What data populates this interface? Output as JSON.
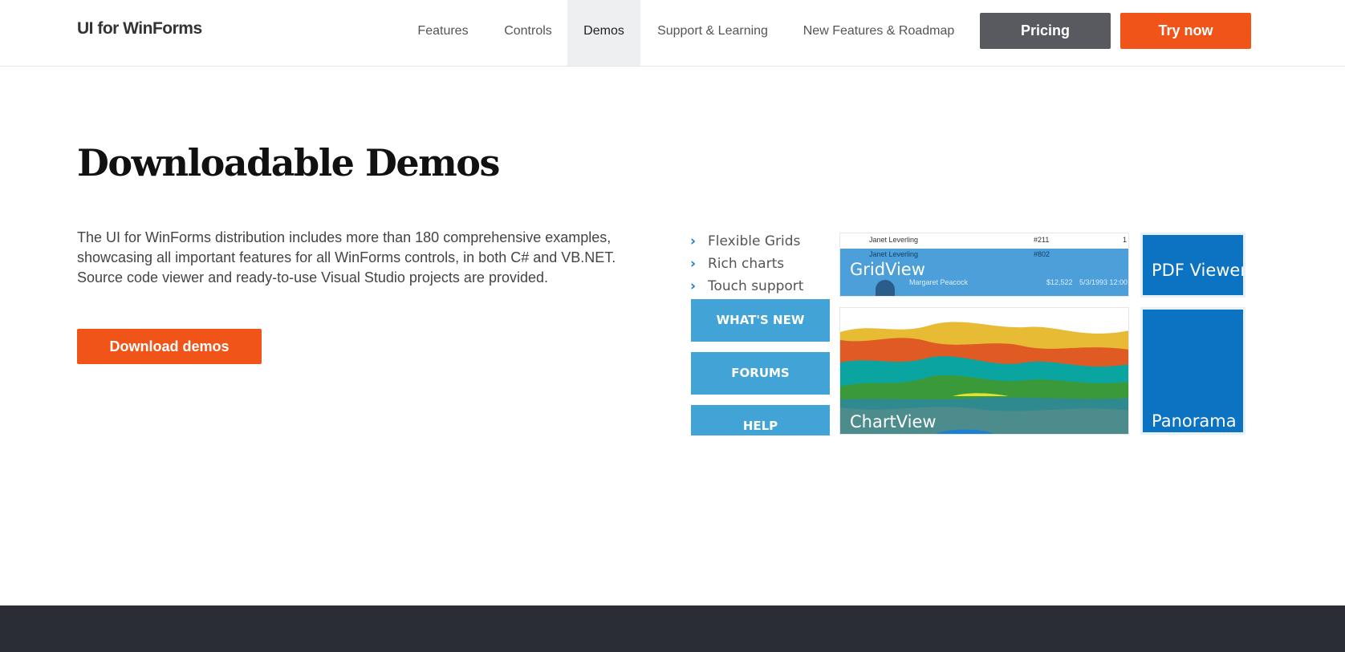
{
  "header": {
    "brand": "UI for WinForms",
    "nav": [
      {
        "label": "Features"
      },
      {
        "label": "Controls"
      },
      {
        "label": "Demos",
        "active": true
      },
      {
        "label": "Support & Learning"
      },
      {
        "label": "New Features & Roadmap"
      }
    ],
    "pricing_label": "Pricing",
    "try_label": "Try now"
  },
  "main": {
    "title": "Downloadable Demos",
    "description": "The UI for WinForms distribution includes more than 180 comprehensive examples, showcasing all important features for all WinForms controls, in both C# and VB.NET. Source code viewer and ready-to-use Visual Studio projects are provided.",
    "download_label": "Download demos"
  },
  "showcase": {
    "features": [
      "Flexible Grids",
      "Rich charts",
      "Touch support"
    ],
    "buttons": {
      "whats_new": "WHAT'S NEW",
      "forums": "FORUMS",
      "help": "HELP"
    },
    "tiles": {
      "gridview": "GridView",
      "chartview": "ChartView",
      "pdf_viewer": "PDF Viewer",
      "panorama": "Panorama"
    },
    "grid_rows": [
      {
        "name": "Janet Leverling",
        "id": "#211",
        "extra": "1"
      },
      {
        "name": "Janet Leverling",
        "id": "#802"
      },
      {
        "name": "Margaret Peacock",
        "amount": "$12,522",
        "date": "5/3/1993 12:00"
      }
    ]
  },
  "colors": {
    "accent_orange": "#f05418",
    "pricing_gray": "#595a5f",
    "tile_blue": "#0b73c1",
    "side_button_blue": "#42a4d6",
    "footer": "#2a2d34"
  }
}
